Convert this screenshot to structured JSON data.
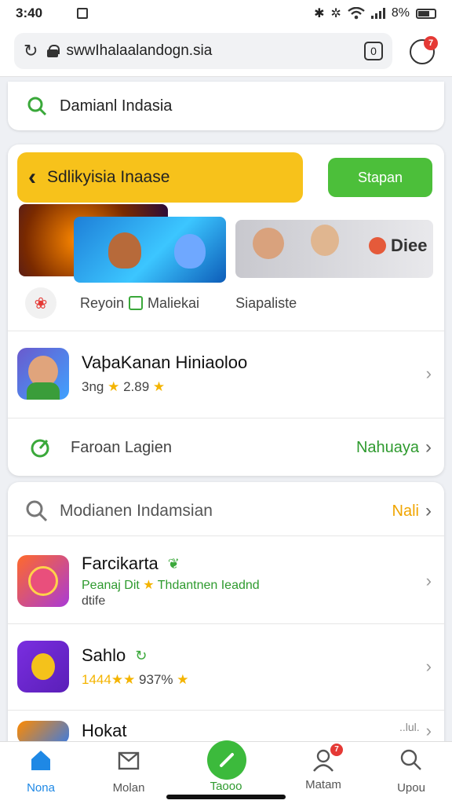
{
  "status": {
    "time": "3:40",
    "battery": "8%"
  },
  "browser": {
    "url": "swwIhalaalandogn.sia",
    "tab_count": "0",
    "menu_badge": "7"
  },
  "search": {
    "text": "Damianl Indasia"
  },
  "promo": {
    "title": "Sdlikyisia Inaase",
    "button": "Stapan",
    "banner_brand": "Diee",
    "tags": [
      "Reyoin",
      "Maliekai",
      "Siapaliste"
    ]
  },
  "featured_app": {
    "name": "VaþaKanan Hiniaoloo",
    "meta_prefix": "3ng",
    "rating": "2.89"
  },
  "link_row": {
    "label": "Faroan Lagien",
    "action": "Nahuaya"
  },
  "section2": {
    "title": "Modianen Indamsian",
    "action": "Nali",
    "apps": [
      {
        "name": "Farcikarta",
        "meta": "Peanaj Dit",
        "meta2": "Thdantnen Ieadnd",
        "meta3": "dtife"
      },
      {
        "name": "Sahlo",
        "meta": "1444",
        "rating": "937%"
      },
      {
        "name": "Hokat",
        "meta": "..lul."
      }
    ]
  },
  "bottom_nav": {
    "items": [
      "Nona",
      "Molan",
      "Taooo",
      "Matam",
      "Upou"
    ],
    "badge": "7"
  },
  "colors": {
    "accent_green": "#4cbf3a",
    "promo_yellow": "#f7c21b",
    "nav_active": "#1e88e5"
  }
}
